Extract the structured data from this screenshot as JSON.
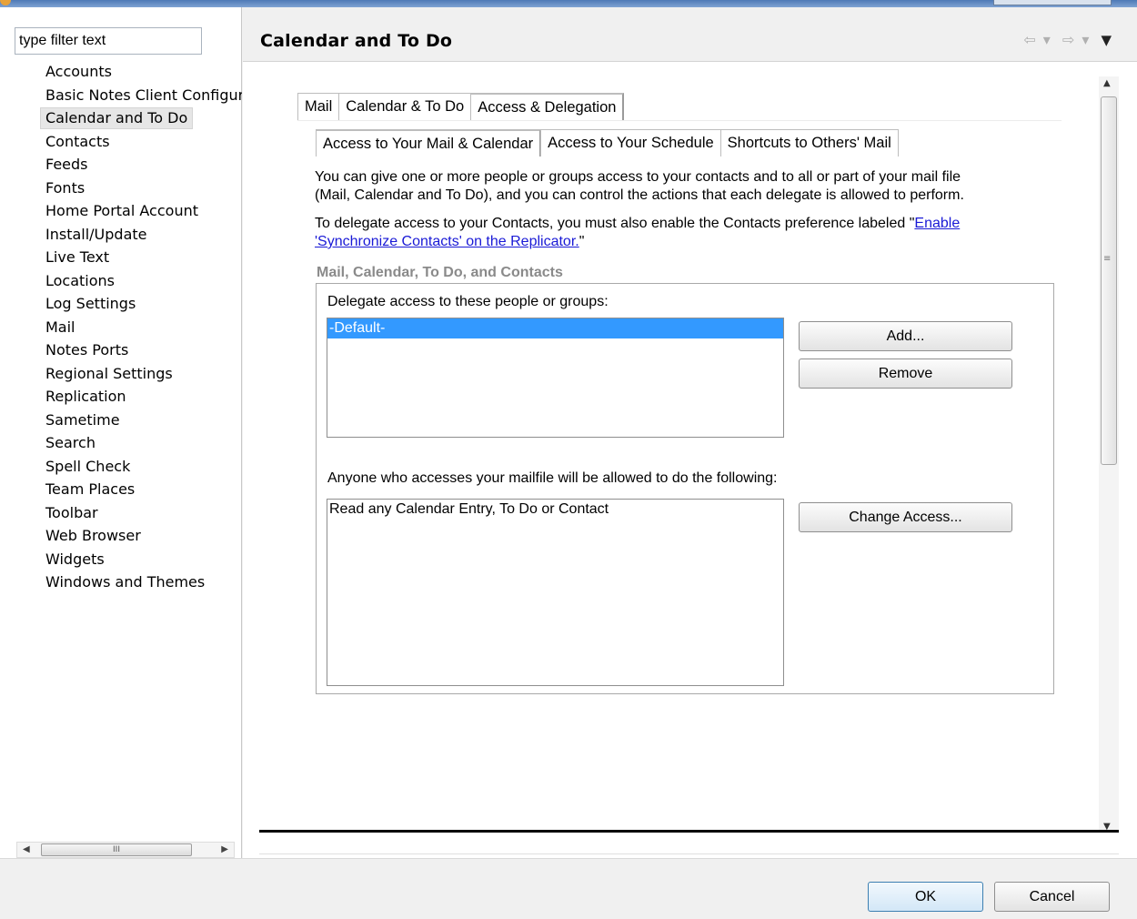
{
  "nav": {
    "filter_placeholder": "type filter text",
    "items": [
      {
        "label": "Accounts"
      },
      {
        "label": "Basic Notes Client Configura"
      },
      {
        "label": "Calendar and To Do"
      },
      {
        "label": "Contacts"
      },
      {
        "label": "Feeds"
      },
      {
        "label": "Fonts"
      },
      {
        "label": "Home Portal Account"
      },
      {
        "label": "Install/Update"
      },
      {
        "label": "Live Text"
      },
      {
        "label": "Locations"
      },
      {
        "label": "Log Settings"
      },
      {
        "label": "Mail"
      },
      {
        "label": "Notes Ports"
      },
      {
        "label": "Regional Settings"
      },
      {
        "label": "Replication"
      },
      {
        "label": "Sametime"
      },
      {
        "label": "Search"
      },
      {
        "label": "Spell Check"
      },
      {
        "label": "Team Places"
      },
      {
        "label": "Toolbar"
      },
      {
        "label": "Web Browser"
      },
      {
        "label": "Widgets"
      },
      {
        "label": "Windows and Themes"
      }
    ],
    "selected_index": 2,
    "scroll_thumb_glyph": "III"
  },
  "header": {
    "title": "Calendar and To Do",
    "back_icon": "⇦",
    "forward_icon": "⇨",
    "dropdown_icon": "▾",
    "menu_icon": "▼"
  },
  "tabs": {
    "outer": [
      "Mail",
      "Calendar & To Do",
      "Access & Delegation"
    ],
    "outer_active": 2,
    "inner": [
      "Access to Your Mail & Calendar",
      "Access to Your Schedule",
      "Shortcuts to Others' Mail"
    ],
    "inner_active": 0
  },
  "intro": {
    "paragraph1_line1": "You can give one or more people or groups access to your contacts and to all or part of your mail file",
    "paragraph1_line2": "(Mail, Calendar and To Do), and you can control the actions that each delegate is allowed to perform.",
    "paragraph2_prefix": "To delegate access to your Contacts, you must also enable the Contacts preference labeled \"",
    "paragraph2_link_part1": "Enable",
    "paragraph2_link_part2": "'Synchronize Contacts' on the Replicator.",
    "paragraph2_suffix": "\""
  },
  "group": {
    "title": "Mail, Calendar, To Do, and Contacts",
    "delegate_label": "Delegate access to these people or groups:",
    "delegates": [
      "-Default-"
    ],
    "add_button": "Add...",
    "remove_button": "Remove",
    "anyone_label": "Anyone who accesses your mailfile will be allowed to do the following:",
    "permissions": [
      "Read any Calendar Entry, To Do or Contact"
    ],
    "change_access_button": "Change Access..."
  },
  "dialog": {
    "ok": "OK",
    "cancel": "Cancel"
  }
}
